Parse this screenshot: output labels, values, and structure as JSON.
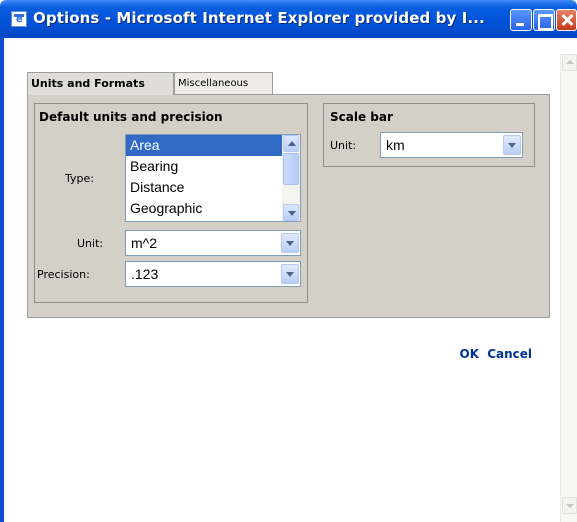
{
  "window": {
    "title": "Options - Microsoft Internet Explorer provided by I..."
  },
  "tabs": [
    {
      "label": "Units and Formats",
      "active": true
    },
    {
      "label": "Miscellaneous",
      "active": false
    }
  ],
  "units_section": {
    "legend": "Default units and precision",
    "type_label": "Type:",
    "type_options": [
      "Area",
      "Bearing",
      "Distance",
      "Geographic"
    ],
    "type_selected": "Area",
    "unit_label": "Unit:",
    "unit_value": "m^2",
    "precision_label": "Precision:",
    "precision_value": ".123"
  },
  "scale_bar_section": {
    "legend": "Scale bar",
    "unit_label": "Unit:",
    "unit_value": "km"
  },
  "actions": {
    "ok_label": "OK",
    "cancel_label": "Cancel"
  },
  "colors": {
    "title_bar": "#0052d9",
    "selection": "#316ac5",
    "panel": "#d4d0c8",
    "link": "#003399"
  }
}
